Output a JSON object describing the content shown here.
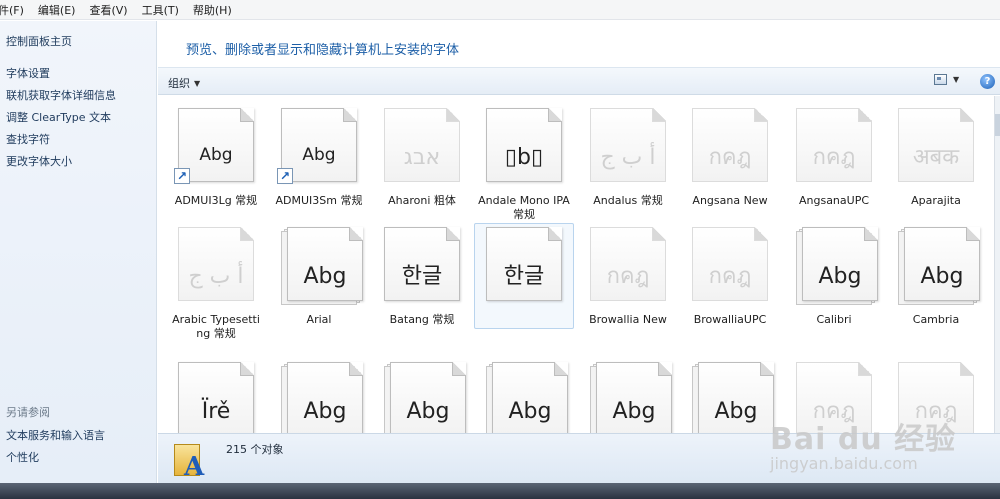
{
  "menubar": {
    "items": [
      "件(F)",
      "编辑(E)",
      "查看(V)",
      "工具(T)",
      "帮助(H)"
    ]
  },
  "sidebar": {
    "home_link": "控制面板主页",
    "links": [
      "字体设置",
      "联机获取字体详细信息",
      "调整 ClearType 文本",
      "查找字符",
      "更改字体大小"
    ],
    "see_also_heading": "另请参阅",
    "see_also_links": [
      "文本服务和输入语言",
      "个性化"
    ]
  },
  "header": {
    "title": "预览、删除或者显示和隐藏计算机上安装的字体"
  },
  "toolbar": {
    "organize_label": "组织",
    "dropdown_glyph": "▼",
    "help_glyph": "?"
  },
  "fonts": [
    {
      "name": "ADMUI3Lg 常规",
      "sample": "Abg",
      "style": "shortcut"
    },
    {
      "name": "ADMUI3Sm 常规",
      "sample": "Abg",
      "style": "shortcut"
    },
    {
      "name": "Aharoni 粗体",
      "sample": "אבג",
      "style": "faded"
    },
    {
      "name": "Andale Mono IPA 常规",
      "sample": "▯b▯",
      "style": "single"
    },
    {
      "name": "Andalus 常规",
      "sample": "أ ب ج",
      "style": "faded"
    },
    {
      "name": "Angsana New",
      "sample": "กคฎ",
      "style": "faded"
    },
    {
      "name": "AngsanaUPC",
      "sample": "กคฎ",
      "style": "faded"
    },
    {
      "name": "Aparajita",
      "sample": "अबक",
      "style": "faded"
    },
    {
      "name": "Arabic Typesetting 常规",
      "sample": "أ ب ج",
      "style": "faded"
    },
    {
      "name": "Arial",
      "sample": "Abg",
      "style": "stack"
    },
    {
      "name": "Batang 常规",
      "sample": "한글",
      "style": "single"
    },
    {
      "name": "BatangChe 常规",
      "sample": "한글",
      "style": "single-selected"
    },
    {
      "name": "Browallia New",
      "sample": "กคฎ",
      "style": "faded"
    },
    {
      "name": "BrowalliaUPC",
      "sample": "กคฎ",
      "style": "faded"
    },
    {
      "name": "Calibri",
      "sample": "Abg",
      "style": "stack"
    },
    {
      "name": "Cambria",
      "sample": "Abg",
      "style": "stack"
    },
    {
      "name": "",
      "sample": "Ïrě",
      "style": "single"
    },
    {
      "name": "",
      "sample": "Abg",
      "style": "stack"
    },
    {
      "name": "",
      "sample": "Abg",
      "style": "stack"
    },
    {
      "name": "",
      "sample": "Abg",
      "style": "stack"
    },
    {
      "name": "",
      "sample": "Abg",
      "style": "stack"
    },
    {
      "name": "",
      "sample": "Abg",
      "style": "stack"
    },
    {
      "name": "",
      "sample": "กคฎ",
      "style": "faded"
    },
    {
      "name": "",
      "sample": "กคฎ",
      "style": "faded"
    }
  ],
  "status": {
    "count_text": "215 个对象"
  },
  "watermark": {
    "main": "Bai du 经验",
    "sub": "jingyan.baidu.com"
  }
}
